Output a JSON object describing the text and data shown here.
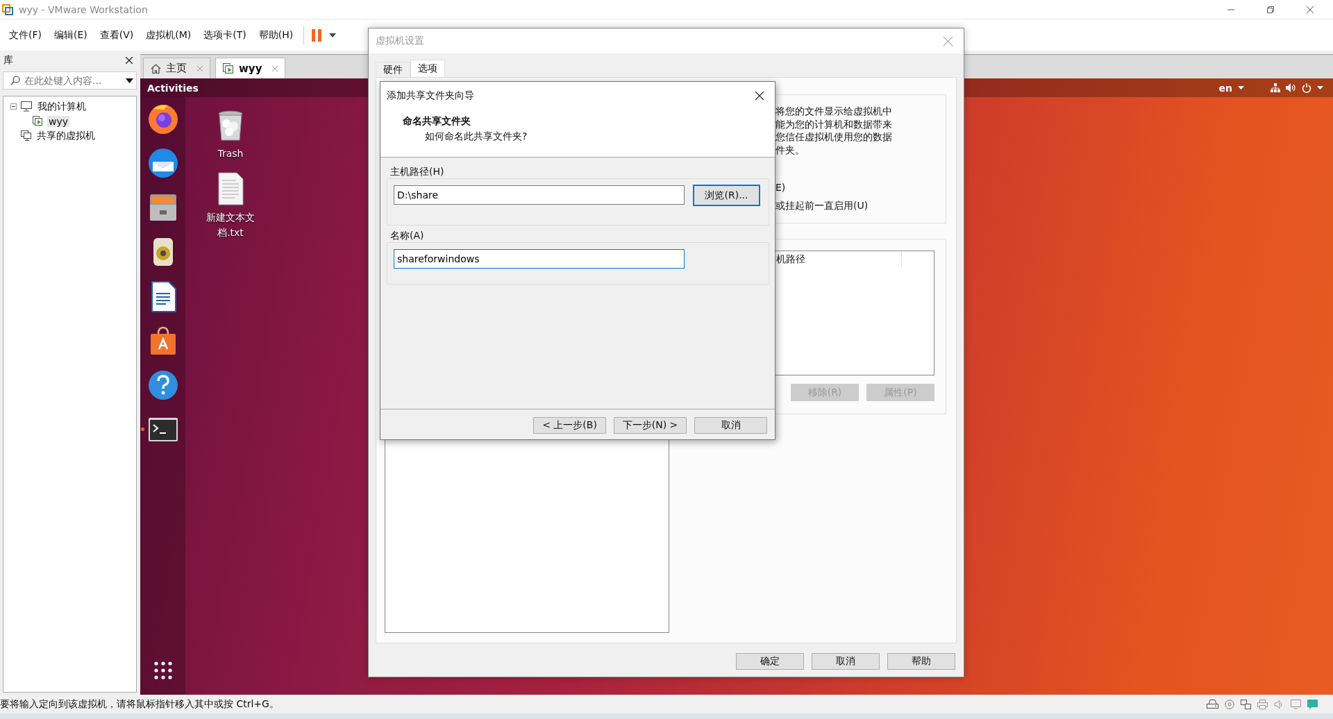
{
  "window": {
    "title": "wyy - VMware Workstation"
  },
  "menu": [
    "文件(F)",
    "编辑(E)",
    "查看(V)",
    "虚拟机(M)",
    "选项卡(T)",
    "帮助(H)"
  ],
  "library": {
    "title": "库",
    "search": {
      "placeholder": "在此处键入内容..."
    },
    "tree": [
      {
        "label": "我的计算机",
        "kind": "computer",
        "expanded": true,
        "selected": false,
        "children": [
          {
            "label": "wyy",
            "kind": "vm",
            "selected": true
          }
        ]
      },
      {
        "label": "共享的虚拟机",
        "kind": "shared",
        "selected": false
      }
    ]
  },
  "tabs": [
    {
      "label": "主页",
      "kind": "home",
      "selected": false
    },
    {
      "label": "wyy",
      "kind": "vm",
      "selected": true
    }
  ],
  "guest": {
    "activities": "Activities",
    "keyboard": "en",
    "dock": [
      {
        "kind": "browser",
        "running": false
      },
      {
        "kind": "mail",
        "running": false
      },
      {
        "kind": "files",
        "running": false
      },
      {
        "kind": "audio",
        "running": false
      },
      {
        "kind": "writer",
        "running": false
      },
      {
        "kind": "store",
        "running": false
      },
      {
        "kind": "help",
        "running": false
      },
      {
        "kind": "terminal",
        "running": true
      }
    ],
    "desktop": [
      {
        "label": "Trash",
        "kind": "trash"
      },
      {
        "label": "新建文本文档.txt",
        "kind": "document"
      }
    ]
  },
  "settings": {
    "title": "虚拟机设置",
    "tabs": [
      {
        "label": "硬件",
        "selected": false
      },
      {
        "label": "选项",
        "selected": true
      }
    ],
    "description": [
      "将您的文件显示给虚拟机中",
      "能为您的计算机和数据带来",
      "您信任虚拟机使用您的数据",
      "件夹。"
    ],
    "options": [
      "E)",
      "或挂起前一直启用(U)"
    ],
    "list_header": "机路径",
    "side_buttons": [
      {
        "label": "移除(R)",
        "disabled": true
      },
      {
        "label": "属性(P)",
        "disabled": true
      }
    ],
    "buttons": [
      "确定",
      "取消",
      "帮助"
    ]
  },
  "wizard": {
    "title": "添加共享文件夹向导",
    "heading": "命名共享文件夹",
    "subheading": "如何命名此共享文件夹?",
    "host_path": {
      "label": "主机路径(H)",
      "value": "D:\\share",
      "focused": false
    },
    "browse": {
      "label": "浏览(R)...",
      "default": true
    },
    "name": {
      "label": "名称(A)",
      "value": "shareforwindows",
      "focused": true
    },
    "buttons": [
      "< 上一步(B)",
      "下一步(N) >",
      "取消"
    ]
  },
  "status_bar": {
    "text": "要将输入定向到该虚拟机，请将鼠标指针移入其中或按 Ctrl+G。"
  }
}
